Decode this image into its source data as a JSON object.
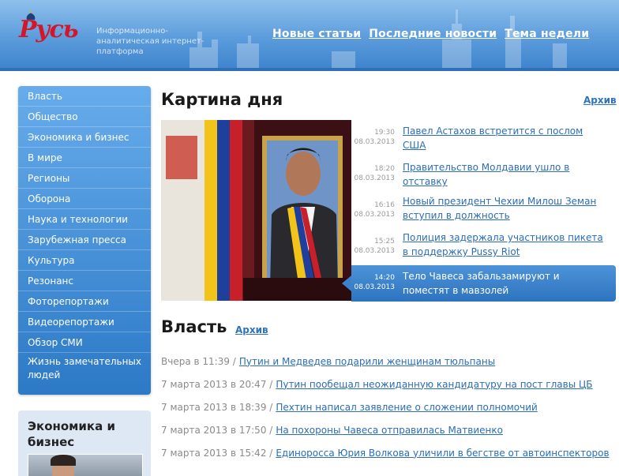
{
  "header": {
    "logo_text": "Русь",
    "tagline": "Информационно-аналитическая интернет-платформа",
    "nav": [
      "Новые статьи",
      "Последние новости",
      "Тема недели"
    ]
  },
  "sidebar": {
    "items": [
      "Власть",
      "Общество",
      "Экономика и бизнес",
      "В мире",
      "Регионы",
      "Оборона",
      "Наука и технологии",
      "Зарубежная пресса",
      "Культура",
      "Резонанс",
      "Фоторепортажи",
      "Видеорепортажи",
      "Обзор СМИ",
      "Жизнь замечательных людей"
    ],
    "box_title": "Экономика и бизнес"
  },
  "picture_of_day": {
    "title": "Картина дня",
    "archive": "Архив",
    "news": [
      {
        "time": "19:30",
        "date": "08.03.2013",
        "text": "Павел Астахов встретится с послом США"
      },
      {
        "time": "18:20",
        "date": "08.03.2013",
        "text": "Правительство Молдавии ушло в отставку"
      },
      {
        "time": "16:16",
        "date": "08.03.2013",
        "text": "Новый президент Чехии Милош Земан вступил в должность"
      },
      {
        "time": "15:25",
        "date": "08.03.2013",
        "text": "Полиция задержала участников пикета в поддержку Pussy Riot"
      },
      {
        "time": "14:20",
        "date": "08.03.2013",
        "text": "Тело Чавеса забальзамируют и поместят в мавзолей"
      }
    ]
  },
  "vlast": {
    "title": "Власть",
    "archive": "Архив",
    "items": [
      {
        "date": "Вчера в 11:39 /",
        "text": "Путин и Медведев подарили женщинам тюльпаны"
      },
      {
        "date": "7 марта 2013 в 20:47 /",
        "text": "Путин пообещал неожиданную кандидатуру на пост главы ЦБ"
      },
      {
        "date": "7 марта 2013 в 18:39 /",
        "text": "Пехтин написал заявление о сложении полномочий"
      },
      {
        "date": "7 марта 2013 в 17:50 /",
        "text": "На похороны Чавеса отправилась Матвиенко"
      },
      {
        "date": "7 марта 2013 в 15:42 /",
        "text": "Единоросса Юрия Волкова уличили в бегстве от автоинспекторов"
      }
    ]
  },
  "colors": {
    "accent": "#2a6db8",
    "header": "#5a9bdb",
    "logo": "#d3172a"
  }
}
